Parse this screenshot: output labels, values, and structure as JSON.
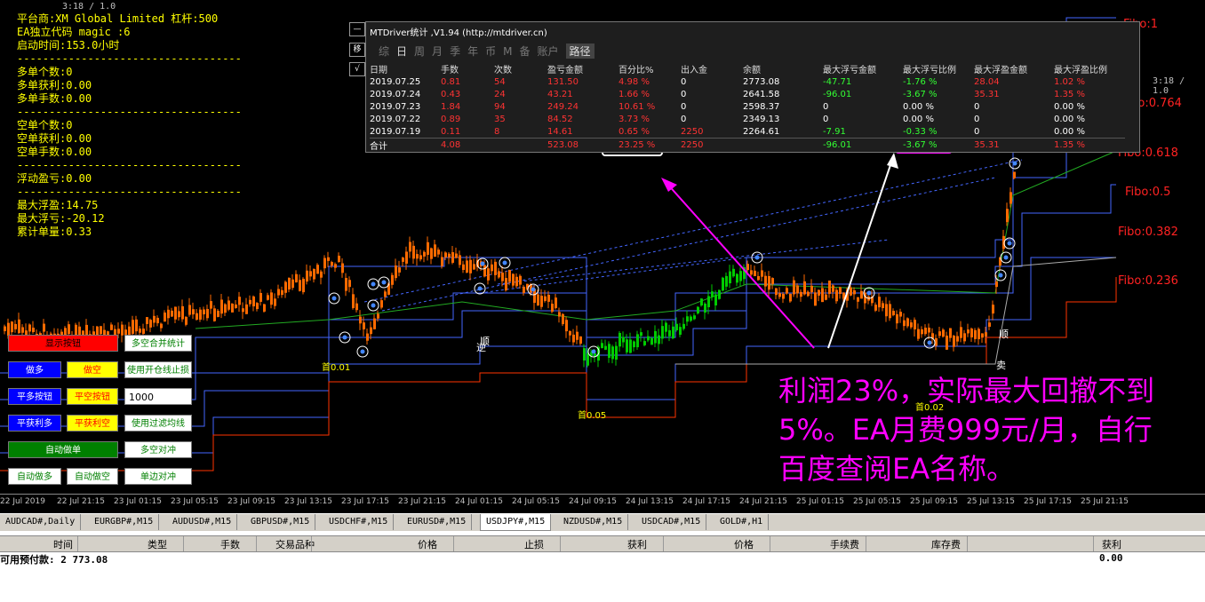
{
  "info": {
    "lines": [
      "平台商:XM Global Limited 杠杆:500",
      "EA独立代码 magic :6",
      "启动时间:153.0小时",
      "-----------------------------------",
      "多单个数:0",
      "多单获利:0.00",
      "多单手数:0.00",
      "-----------------------------------",
      "空单个数:0",
      "空单获利:0.00",
      "空单手数:0.00",
      "-----------------------------------",
      "浮动盈亏:0.00",
      "-----------------------------------",
      "最大浮盈:14.75",
      "最大浮亏:-20.12",
      "累计单量:0.33"
    ]
  },
  "version_labels": [
    "3:18 / 1.0",
    "3:18 / 1.0"
  ],
  "fibo": [
    "Fibo:1",
    "Fibo:0.764",
    "Fibo:0.618",
    "Fibo:0.5",
    "Fibo:0.382",
    "Fibo:0.236"
  ],
  "buttons": {
    "show_panel": "显示按钮",
    "multi_merge": "多空合并统计",
    "buy": "做多",
    "sell": "做空",
    "use_open_sl": "使用开仓线止损",
    "close_buy": "平多按钮",
    "close_sell": "平空按钮",
    "lots_value": "1000",
    "close_buy_profit": "平获利多",
    "close_sell_profit": "平获利空",
    "use_filter": "使用过滤均线",
    "auto_open": "自动做单",
    "hedge": "多空对冲",
    "auto_buy": "自动做多",
    "auto_sell": "自动做空",
    "one_side_hedge": "单边对冲"
  },
  "panel": {
    "title": "MTDriver统计 ,V1.94 (http://mtdriver.cn)",
    "tabs": [
      "综",
      "日",
      "周",
      "月",
      "季",
      "年",
      "币",
      "M",
      "备",
      "账户",
      "路径"
    ],
    "side_buttons": [
      "—",
      "移",
      "√"
    ],
    "columns": [
      "日期",
      "手数",
      "次数",
      "盈亏金额",
      "百分比%",
      "出入金",
      "余额",
      "最大浮亏金额",
      "最大浮亏比例",
      "最大浮盈金额",
      "最大浮盈比例"
    ],
    "rows": [
      [
        "2019.07.25",
        "0.81",
        "54",
        "131.50",
        "4.98 %",
        "0",
        "2773.08",
        "-47.71",
        "-1.76 %",
        "28.04",
        "1.02 %"
      ],
      [
        "2019.07.24",
        "0.43",
        "24",
        "43.21",
        "1.66 %",
        "0",
        "2641.58",
        "-96.01",
        "-3.67 %",
        "35.31",
        "1.35 %"
      ],
      [
        "2019.07.23",
        "1.84",
        "94",
        "249.24",
        "10.61 %",
        "0",
        "2598.37",
        "0",
        "0.00 %",
        "0",
        "0.00 %"
      ],
      [
        "2019.07.22",
        "0.89",
        "35",
        "84.52",
        "3.73 %",
        "0",
        "2349.13",
        "0",
        "0.00 %",
        "0",
        "0.00 %"
      ],
      [
        "2019.07.19",
        "0.11",
        "8",
        "14.61",
        "0.65 %",
        "2250",
        "2264.61",
        "-7.91",
        "-0.33 %",
        "0",
        "0.00 %"
      ]
    ],
    "total": [
      "合计",
      "4.08",
      "",
      "523.08",
      "23.25 %",
      "2250",
      "",
      "-96.01",
      "-3.67 %",
      "35.31",
      "1.35 %"
    ]
  },
  "chart_labels": {
    "first1": "首0.01",
    "first2": "首0.05",
    "first3": "首0.02",
    "shun1": "顺",
    "shun2": "顺",
    "ni": "逆",
    "mai": "卖"
  },
  "annotation": "利润23%，实际最大回撤不到5%。EA月费999元/月，自行百度查阅EA名称。",
  "time_axis": [
    "22 Jul 2019",
    "22 Jul 21:15",
    "23 Jul 01:15",
    "23 Jul 05:15",
    "23 Jul 09:15",
    "23 Jul 13:15",
    "23 Jul 17:15",
    "23 Jul 21:15",
    "24 Jul 01:15",
    "24 Jul 05:15",
    "24 Jul 09:15",
    "24 Jul 13:15",
    "24 Jul 17:15",
    "24 Jul 21:15",
    "25 Jul 01:15",
    "25 Jul 05:15",
    "25 Jul 09:15",
    "25 Jul 13:15",
    "25 Jul 17:15",
    "25 Jul 21:15"
  ],
  "symbol_tabs": [
    "AUDCAD#,Daily",
    "EURGBP#,M15",
    "AUDUSD#,M15",
    "GBPUSD#,M15",
    "USDCHF#,M15",
    "EURUSD#,M15",
    "USDJPY#,M15",
    "NZDUSD#,M15",
    "USDCAD#,M15",
    "GOLD#,H1"
  ],
  "active_tab": "USDJPY#,M15",
  "terminal_columns": [
    "时间",
    "类型",
    "手数",
    "交易品种",
    "价格",
    "止损",
    "获利",
    "价格",
    "手续费",
    "库存费",
    "获利"
  ],
  "balance": {
    "label": "可用预付款: 2 773.08",
    "value": "0.00"
  },
  "colors": {
    "up_candle": "#ff6a00",
    "down_candle": "#00cc00",
    "band": "#4466ff",
    "fibo_red": "#ff3300",
    "highlight_white": "#ffffff",
    "highlight_magenta": "#ff00ff"
  }
}
